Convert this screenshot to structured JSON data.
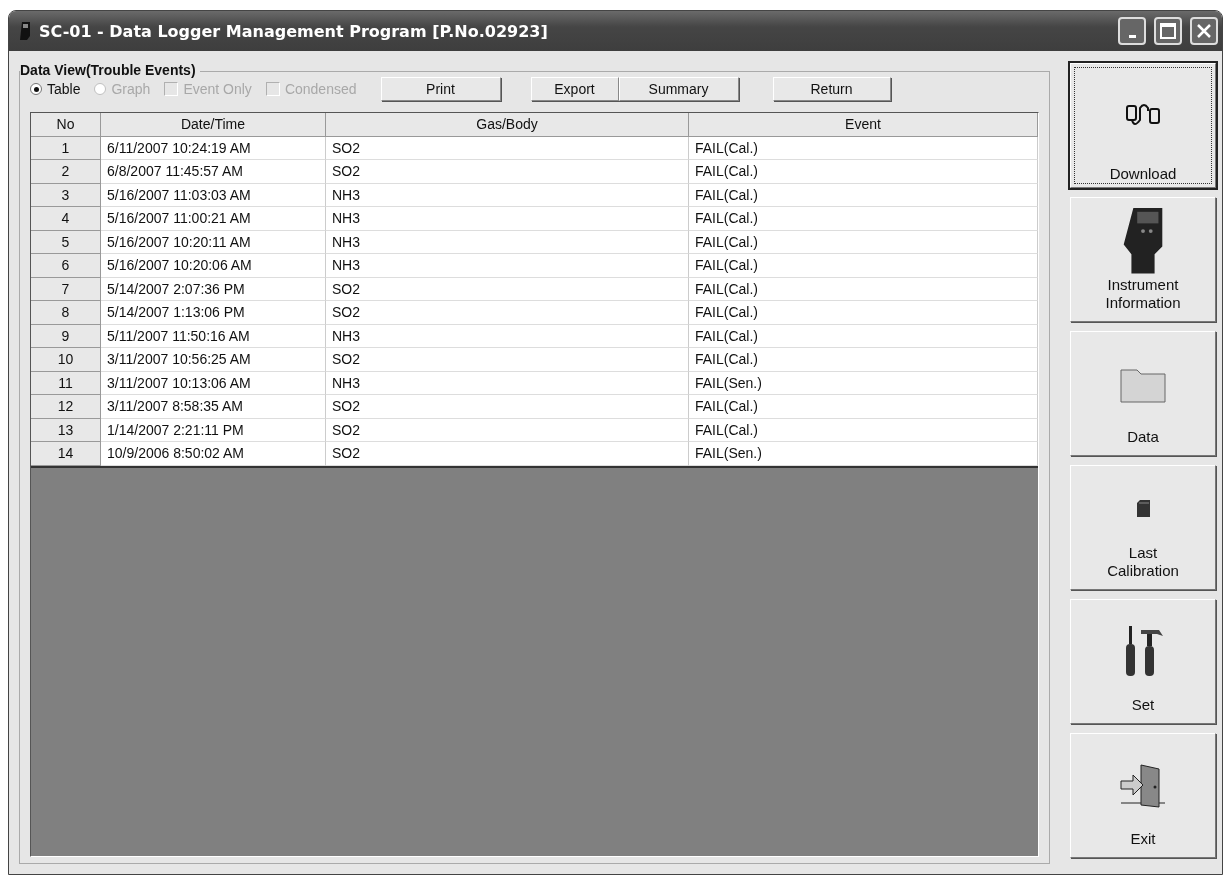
{
  "window": {
    "title": "SC-01  - Data Logger Management Program [P.No.02923]"
  },
  "group": {
    "title": "Data View(Trouble Events)",
    "options": [
      {
        "kind": "radio",
        "label": "Table",
        "selected": true,
        "disabled": false
      },
      {
        "kind": "radio",
        "label": "Graph",
        "selected": false,
        "disabled": true
      },
      {
        "kind": "checkbox",
        "label": "Event Only",
        "checked": false,
        "disabled": true
      },
      {
        "kind": "checkbox",
        "label": "Condensed",
        "checked": false,
        "disabled": true
      }
    ],
    "buttons": [
      "Print",
      "Export",
      "Summary"
    ],
    "return_button": "Return"
  },
  "table": {
    "columns": [
      "No",
      "Date/Time",
      "Gas/Body",
      "Event"
    ],
    "rows": [
      [
        "1",
        "6/11/2007 10:24:19 AM",
        "SO2",
        "FAIL(Cal.)"
      ],
      [
        "2",
        "6/8/2007 11:45:57 AM",
        "SO2",
        "FAIL(Cal.)"
      ],
      [
        "3",
        "5/16/2007 11:03:03 AM",
        "NH3",
        "FAIL(Cal.)"
      ],
      [
        "4",
        "5/16/2007 11:00:21 AM",
        "NH3",
        "FAIL(Cal.)"
      ],
      [
        "5",
        "5/16/2007 10:20:11 AM",
        "NH3",
        "FAIL(Cal.)"
      ],
      [
        "6",
        "5/16/2007 10:20:06 AM",
        "NH3",
        "FAIL(Cal.)"
      ],
      [
        "7",
        "5/14/2007 2:07:36 PM",
        "SO2",
        "FAIL(Cal.)"
      ],
      [
        "8",
        "5/14/2007 1:13:06 PM",
        "SO2",
        "FAIL(Cal.)"
      ],
      [
        "9",
        "5/11/2007 11:50:16 AM",
        "NH3",
        "FAIL(Cal.)"
      ],
      [
        "10",
        "3/11/2007 10:56:25 AM",
        "SO2",
        "FAIL(Cal.)"
      ],
      [
        "11",
        "3/11/2007 10:13:06 AM",
        "NH3",
        "FAIL(Sen.)"
      ],
      [
        "12",
        "3/11/2007 8:58:35 AM",
        "SO2",
        "FAIL(Cal.)"
      ],
      [
        "13",
        "1/14/2007 2:21:11 PM",
        "SO2",
        "FAIL(Cal.)"
      ],
      [
        "14",
        "10/9/2006 8:50:02 AM",
        "SO2",
        "FAIL(Sen.)"
      ]
    ]
  },
  "sidebar": {
    "items": [
      {
        "kind": "download",
        "label": "Download",
        "focused": true
      },
      {
        "kind": "instrument",
        "label": "Instrument\nInformation",
        "focused": false
      },
      {
        "kind": "folder",
        "label": "Data",
        "focused": false
      },
      {
        "kind": "calibration",
        "label": "Last\nCalibration",
        "focused": false
      },
      {
        "kind": "tools",
        "label": "Set",
        "focused": false
      },
      {
        "kind": "exit",
        "label": "Exit",
        "focused": false
      }
    ]
  }
}
